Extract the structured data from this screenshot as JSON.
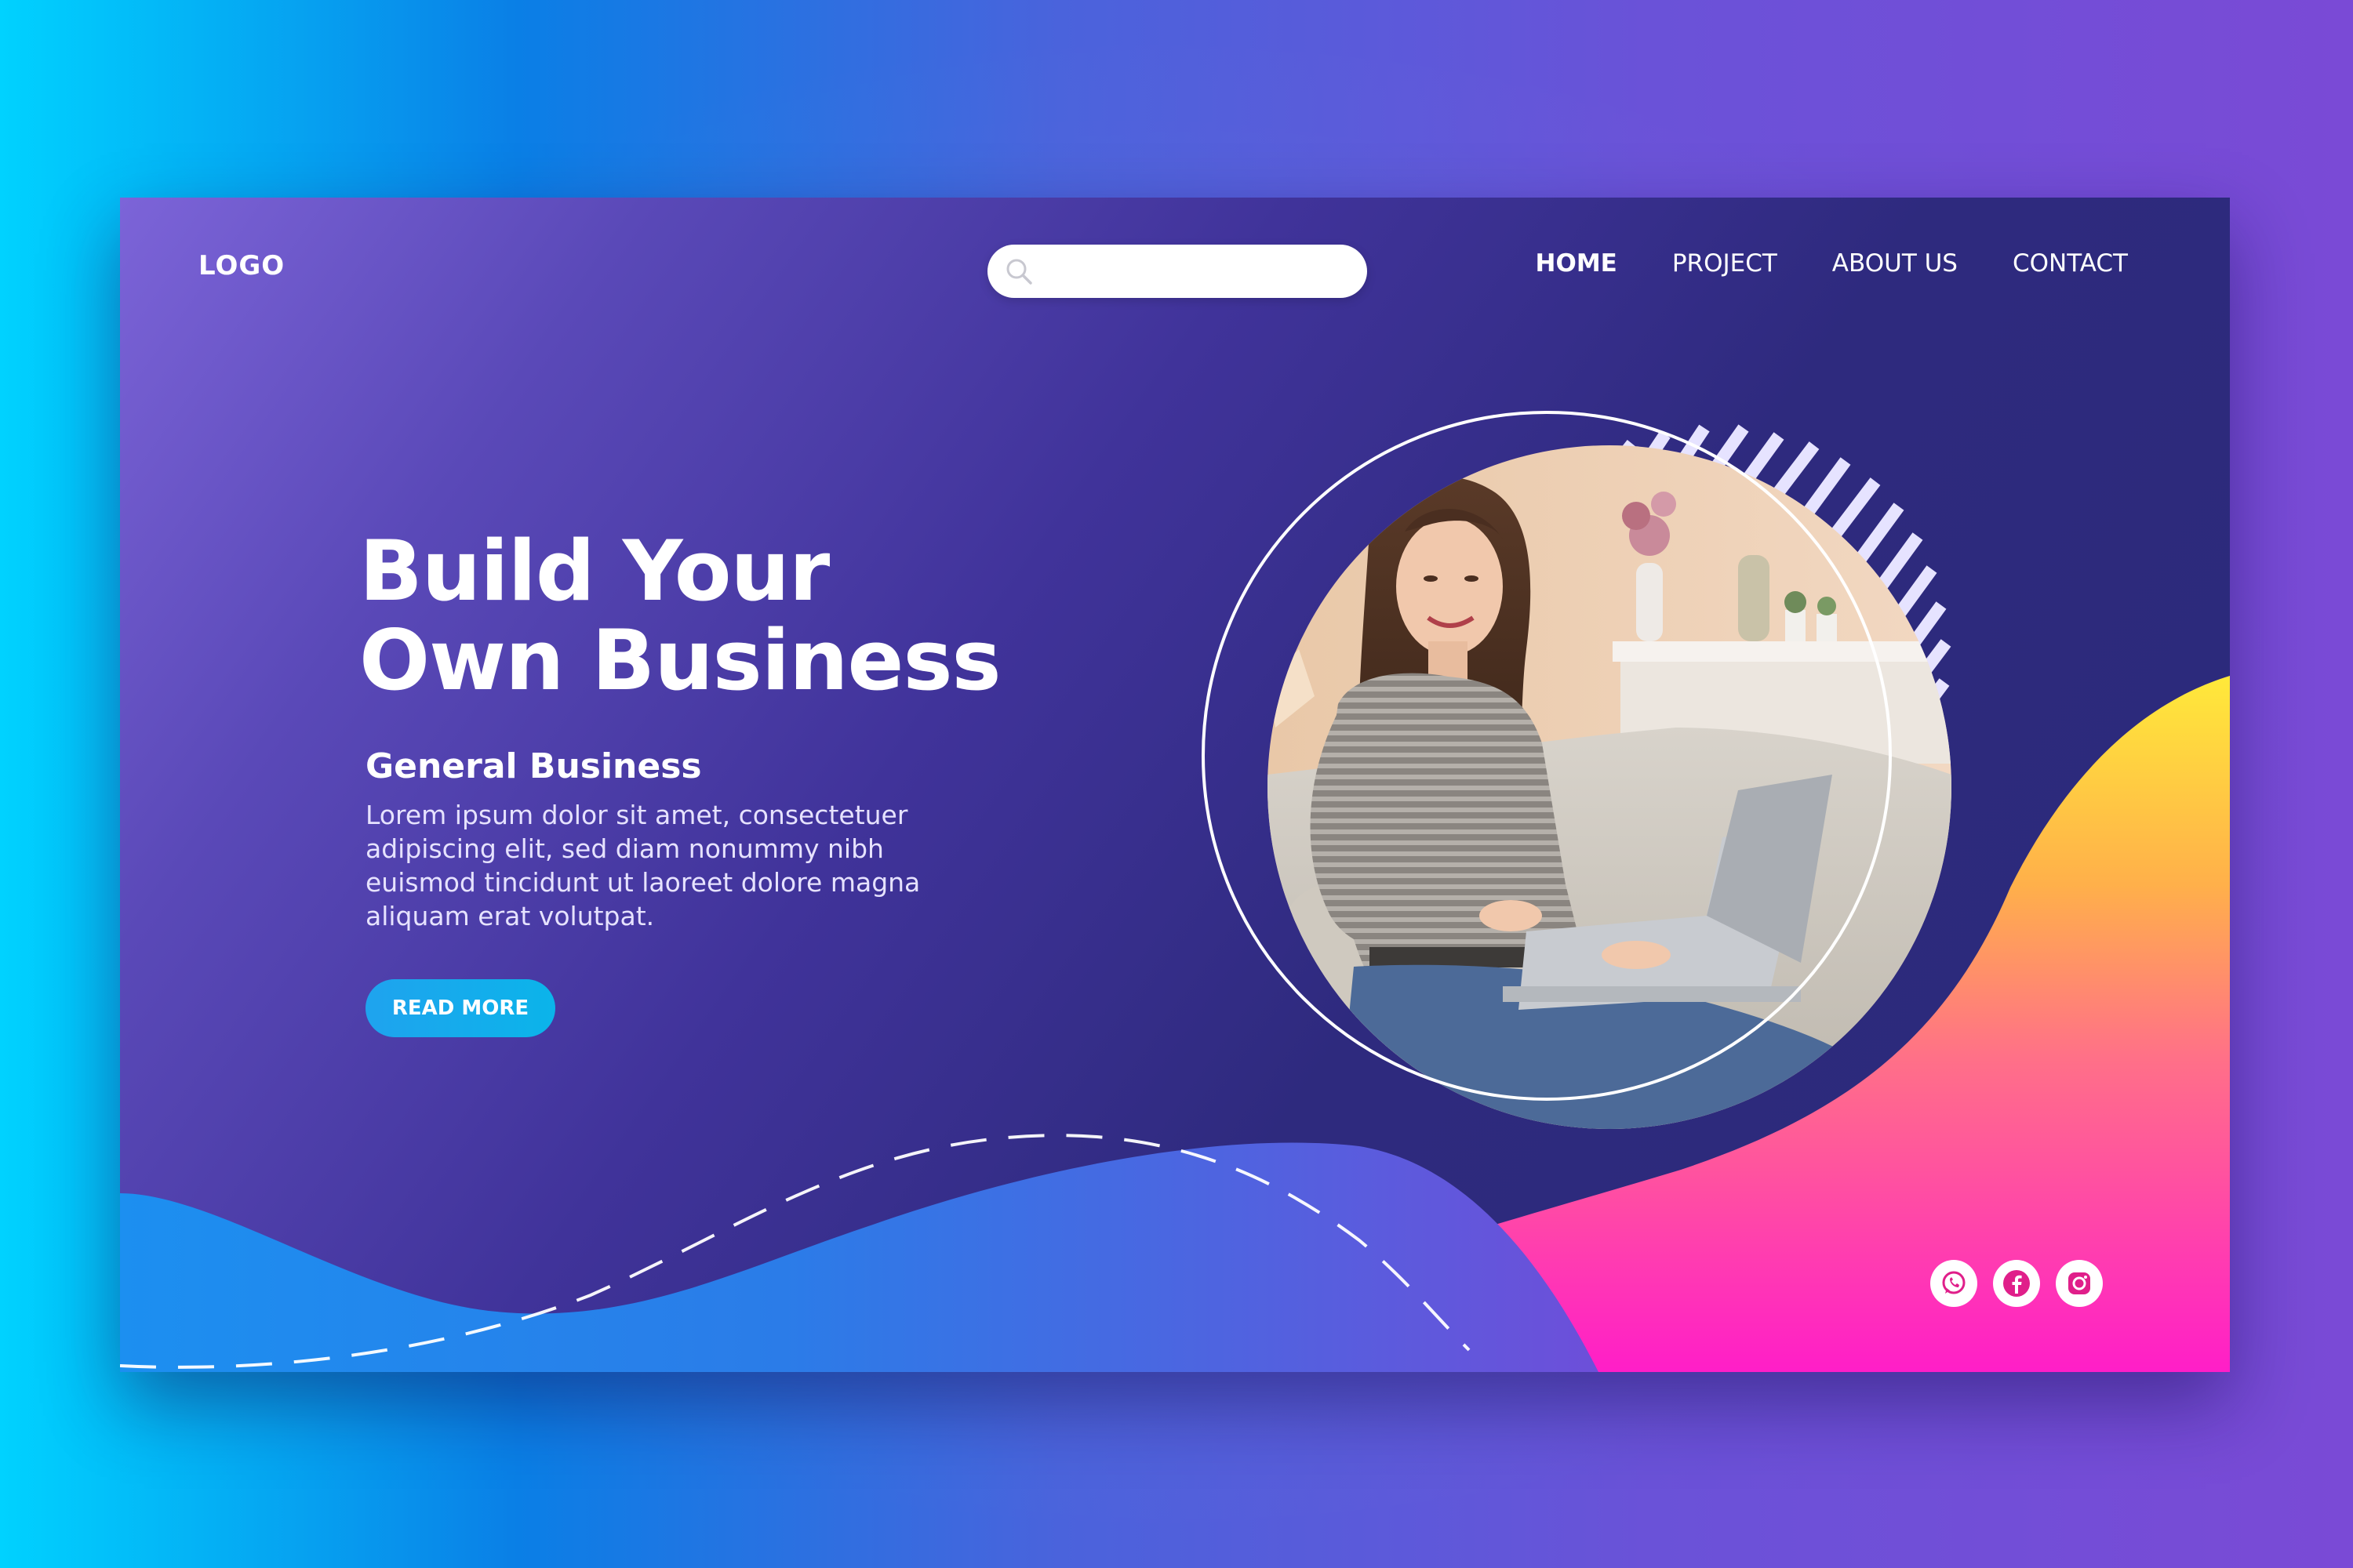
{
  "header": {
    "logo": "LOGO",
    "search": {
      "placeholder": ""
    },
    "nav": [
      {
        "label": "HOME",
        "active": true
      },
      {
        "label": "PROJECT",
        "active": false
      },
      {
        "label": "ABOUT US",
        "active": false
      },
      {
        "label": "CONTACT",
        "active": false
      }
    ]
  },
  "hero": {
    "title_lines": [
      "Build Your",
      "Own Business"
    ],
    "subtitle": "General Business",
    "body_lines": [
      "Lorem ipsum dolor sit amet, consectetuer",
      "adipiscing elit, sed diam nonummy nibh",
      "euismod tincidunt ut laoreet dolore magna",
      "aliquam erat volutpat."
    ],
    "cta_label": "READ MORE"
  },
  "social": [
    {
      "name": "whatsapp-icon"
    },
    {
      "name": "facebook-icon"
    },
    {
      "name": "instagram-icon"
    }
  ],
  "colors": {
    "card_dark": "#2b2a7a",
    "card_light": "#7c64d8",
    "accent_blue": "#1fa3ee",
    "accent_pink": "#ff1ec8",
    "accent_yellow": "#ffe93a",
    "social_icon": "#e01f8a"
  }
}
